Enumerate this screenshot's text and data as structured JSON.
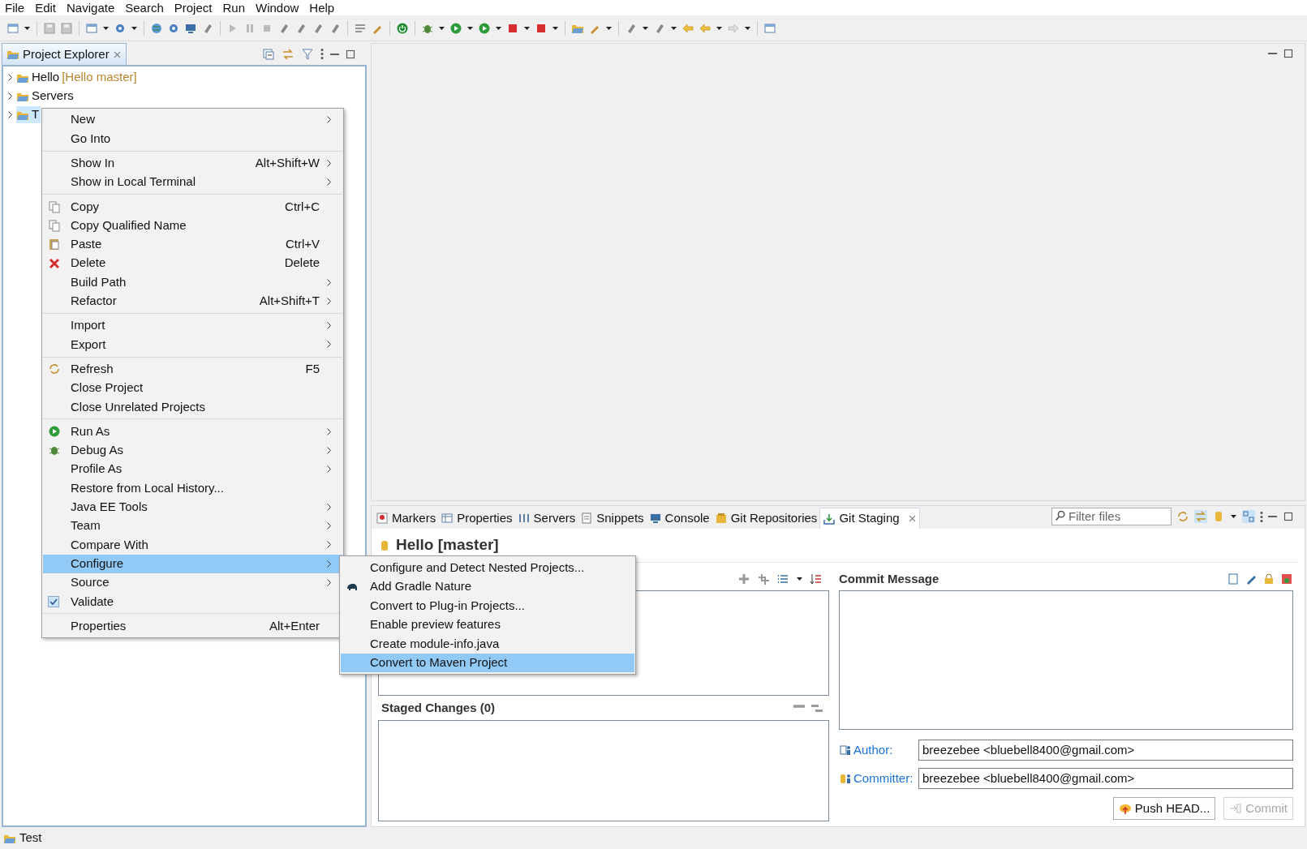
{
  "menu_bar": [
    "File",
    "Edit",
    "Navigate",
    "Search",
    "Project",
    "Run",
    "Window",
    "Help"
  ],
  "project_explorer": {
    "title": "Project Explorer",
    "tree": [
      {
        "label": "Hello",
        "branch": "[Hello master]",
        "selected": false
      },
      {
        "label": "Servers",
        "selected": false
      },
      {
        "label": "T",
        "selected": true
      }
    ]
  },
  "context_menu": {
    "groups": [
      [
        {
          "label": "New",
          "submenu": true,
          "selected": false
        },
        {
          "label": "Go Into",
          "selected": false
        }
      ],
      [
        {
          "label": "Show In",
          "shortcut": "Alt+Shift+W",
          "submenu": true,
          "selected": false
        },
        {
          "label": "Show in Local Terminal",
          "submenu": true,
          "selected": false
        }
      ],
      [
        {
          "label": "Copy",
          "shortcut": "Ctrl+C",
          "selected": false
        },
        {
          "label": "Copy Qualified Name",
          "selected": false
        },
        {
          "label": "Paste",
          "shortcut": "Ctrl+V",
          "selected": false
        },
        {
          "label": "Delete",
          "shortcut": "Delete",
          "selected": false
        },
        {
          "label": "Build Path",
          "submenu": true,
          "selected": false
        },
        {
          "label": "Refactor",
          "shortcut": "Alt+Shift+T",
          "submenu": true,
          "selected": false
        }
      ],
      [
        {
          "label": "Import",
          "submenu": true,
          "selected": false
        },
        {
          "label": "Export",
          "submenu": true,
          "selected": false
        }
      ],
      [
        {
          "label": "Refresh",
          "shortcut": "F5",
          "selected": false
        },
        {
          "label": "Close Project",
          "selected": false
        },
        {
          "label": "Close Unrelated Projects",
          "selected": false
        }
      ],
      [
        {
          "label": "Run As",
          "submenu": true,
          "selected": false
        },
        {
          "label": "Debug As",
          "submenu": true,
          "selected": false
        },
        {
          "label": "Profile As",
          "submenu": true,
          "selected": false
        },
        {
          "label": "Restore from Local History...",
          "selected": false
        },
        {
          "label": "Java EE Tools",
          "submenu": true,
          "selected": false
        },
        {
          "label": "Team",
          "submenu": true,
          "selected": false
        },
        {
          "label": "Compare With",
          "submenu": true,
          "selected": false
        },
        {
          "label": "Configure",
          "submenu": true,
          "selected": true
        },
        {
          "label": "Source",
          "submenu": true,
          "selected": false
        },
        {
          "label": "Validate",
          "kind": "check",
          "checked": true,
          "selected": false
        }
      ],
      [
        {
          "label": "Properties",
          "shortcut": "Alt+Enter",
          "selected": false
        }
      ]
    ]
  },
  "submenu": {
    "items": [
      {
        "label": "Configure and Detect Nested Projects...",
        "selected": false
      },
      {
        "label": "Add Gradle Nature",
        "selected": false
      },
      {
        "label": "Convert to Plug-in Projects...",
        "selected": false
      },
      {
        "label": "Enable preview features",
        "selected": false
      },
      {
        "label": "Create module-info.java",
        "selected": false
      },
      {
        "label": "Convert to Maven Project",
        "selected": true
      }
    ]
  },
  "bottom_panel": {
    "tabs": [
      {
        "label": "Markers",
        "selected": false
      },
      {
        "label": "Properties",
        "selected": false
      },
      {
        "label": "Servers",
        "selected": false
      },
      {
        "label": "Snippets",
        "selected": false
      },
      {
        "label": "Console",
        "selected": false
      },
      {
        "label": "Git Repositories",
        "selected": false
      },
      {
        "label": "Git Staging",
        "selected": true
      }
    ],
    "filter": {
      "placeholder": "Filter files"
    },
    "repository": "Hello [master]",
    "staged_title": "Staged Changes (0)",
    "commit_title": "Commit Message",
    "author_label": "Author:",
    "author": "breezebee <bluebell8400@gmail.com>",
    "committer_label": "Committer:",
    "committer": "breezebee <bluebell8400@gmail.com>",
    "buttons": [
      {
        "label": "Push HEAD...",
        "disabled": false
      },
      {
        "label": "Commit",
        "disabled": true
      }
    ]
  },
  "status_bar": "Test"
}
